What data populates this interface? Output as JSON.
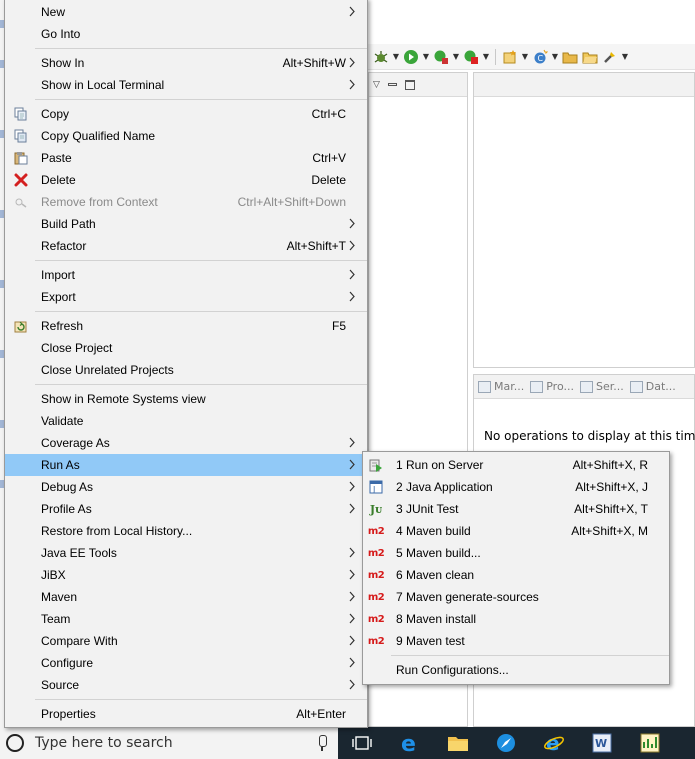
{
  "main_menu": {
    "items": [
      {
        "label": "New",
        "shortcut": "",
        "submenu": true
      },
      {
        "label": "Go Into",
        "shortcut": "",
        "submenu": false
      },
      {
        "label": "Show In",
        "shortcut": "Alt+Shift+W",
        "submenu": true
      },
      {
        "label": "Show in Local Terminal",
        "shortcut": "",
        "submenu": true
      },
      {
        "label": "Copy",
        "shortcut": "Ctrl+C",
        "submenu": false,
        "icon": "copy-icon"
      },
      {
        "label": "Copy Qualified Name",
        "shortcut": "",
        "submenu": false,
        "icon": "copy-qualified-name-icon"
      },
      {
        "label": "Paste",
        "shortcut": "Ctrl+V",
        "submenu": false,
        "icon": "paste-icon"
      },
      {
        "label": "Delete",
        "shortcut": "Delete",
        "submenu": false,
        "icon": "delete-red-x-icon"
      },
      {
        "label": "Remove from Context",
        "shortcut": "Ctrl+Alt+Shift+Down",
        "submenu": false,
        "disabled": true,
        "icon": "remove-from-context-icon"
      },
      {
        "label": "Build Path",
        "shortcut": "",
        "submenu": true
      },
      {
        "label": "Refactor",
        "shortcut": "Alt+Shift+T",
        "submenu": true
      },
      {
        "label": "Import",
        "shortcut": "",
        "submenu": true
      },
      {
        "label": "Export",
        "shortcut": "",
        "submenu": true
      },
      {
        "label": "Refresh",
        "shortcut": "F5",
        "submenu": false,
        "icon": "refresh-icon"
      },
      {
        "label": "Close Project",
        "shortcut": "",
        "submenu": false
      },
      {
        "label": "Close Unrelated Projects",
        "shortcut": "",
        "submenu": false
      },
      {
        "label": "Show in Remote Systems view",
        "shortcut": "",
        "submenu": false
      },
      {
        "label": "Validate",
        "shortcut": "",
        "submenu": false
      },
      {
        "label": "Coverage As",
        "shortcut": "",
        "submenu": true
      },
      {
        "label": "Run As",
        "shortcut": "",
        "submenu": true,
        "highlighted": true
      },
      {
        "label": "Debug As",
        "shortcut": "",
        "submenu": true
      },
      {
        "label": "Profile As",
        "shortcut": "",
        "submenu": true
      },
      {
        "label": "Restore from Local History...",
        "shortcut": "",
        "submenu": false
      },
      {
        "label": "Java EE Tools",
        "shortcut": "",
        "submenu": true
      },
      {
        "label": "JiBX",
        "shortcut": "",
        "submenu": true
      },
      {
        "label": "Maven",
        "shortcut": "",
        "submenu": true
      },
      {
        "label": "Team",
        "shortcut": "",
        "submenu": true
      },
      {
        "label": "Compare With",
        "shortcut": "",
        "submenu": true
      },
      {
        "label": "Configure",
        "shortcut": "",
        "submenu": true
      },
      {
        "label": "Source",
        "shortcut": "",
        "submenu": true
      },
      {
        "label": "Properties",
        "shortcut": "Alt+Enter",
        "submenu": false
      }
    ]
  },
  "run_as_menu": {
    "items": [
      {
        "label": "1 Run on Server",
        "shortcut": "Alt+Shift+X, R",
        "icon": "run-on-server-icon"
      },
      {
        "label": "2 Java Application",
        "shortcut": "Alt+Shift+X, J",
        "icon": "java-application-icon"
      },
      {
        "label": "3 JUnit Test",
        "shortcut": "Alt+Shift+X, T",
        "icon": "junit-icon",
        "icon_text": "Jᴜ"
      },
      {
        "label": "4 Maven build",
        "shortcut": "Alt+Shift+X, M",
        "icon": "maven-m2-icon",
        "icon_text": "m2"
      },
      {
        "label": "5 Maven build...",
        "shortcut": "",
        "icon": "maven-m2-icon",
        "icon_text": "m2"
      },
      {
        "label": "6 Maven clean",
        "shortcut": "",
        "icon": "maven-m2-icon",
        "icon_text": "m2"
      },
      {
        "label": "7 Maven generate-sources",
        "shortcut": "",
        "icon": "maven-m2-icon",
        "icon_text": "m2"
      },
      {
        "label": "8 Maven install",
        "shortcut": "",
        "icon": "maven-m2-icon",
        "icon_text": "m2"
      },
      {
        "label": "9 Maven test",
        "shortcut": "",
        "icon": "maven-m2-icon",
        "icon_text": "m2"
      },
      {
        "label": "Run Configurations...",
        "shortcut": ""
      }
    ]
  },
  "ide": {
    "bottom_view_tabs": [
      "Mar...",
      "Pro...",
      "Ser...",
      "Dat..."
    ],
    "no_operations_text": "No operations to display at this time."
  },
  "taskbar": {
    "search_placeholder": "Type here to search"
  },
  "colors": {
    "menu_background": "#f2f2f2",
    "highlight": "#91c9f7",
    "maven_red": "#d61b1b",
    "taskbar": "#1a2630"
  }
}
